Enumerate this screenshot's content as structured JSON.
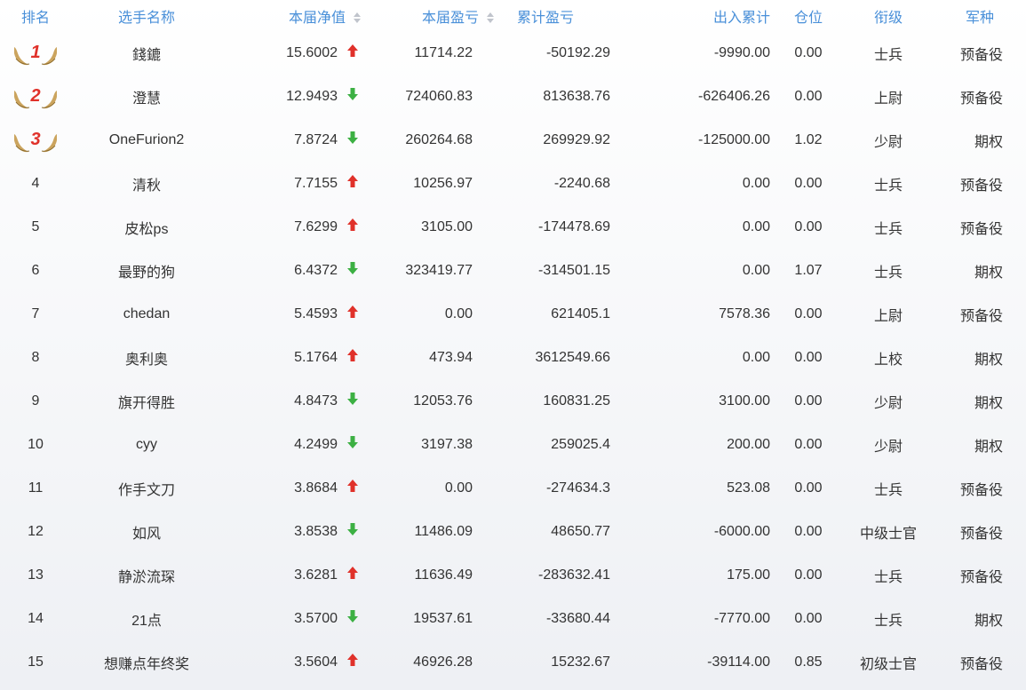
{
  "colors": {
    "header": "#4a90d9",
    "up": "#e0312a",
    "down": "#3cb043",
    "gold": "#c59a4c",
    "rank_red": "#e0312a"
  },
  "header": {
    "rank": "排名",
    "name": "选手名称",
    "net_value": "本届净值",
    "season_pnl": "本届盈亏",
    "total_pnl": "累计盈亏",
    "in_out": "出入累计",
    "position": "仓位",
    "grade": "衔级",
    "branch": "军种"
  },
  "rows": [
    {
      "rank": "1",
      "name": "錢鏕",
      "net_value": "15.6002",
      "trend": "up",
      "season_pnl": "11714.22",
      "total_pnl": "-50192.29",
      "in_out": "-9990.00",
      "position": "0.00",
      "grade": "士兵",
      "branch": "预备役"
    },
    {
      "rank": "2",
      "name": "澄慧",
      "net_value": "12.9493",
      "trend": "down",
      "season_pnl": "724060.83",
      "total_pnl": "813638.76",
      "in_out": "-626406.26",
      "position": "0.00",
      "grade": "上尉",
      "branch": "预备役"
    },
    {
      "rank": "3",
      "name": "OneFurion2",
      "net_value": "7.8724",
      "trend": "down",
      "season_pnl": "260264.68",
      "total_pnl": "269929.92",
      "in_out": "-125000.00",
      "position": "1.02",
      "grade": "少尉",
      "branch": "期权"
    },
    {
      "rank": "4",
      "name": "清秋",
      "net_value": "7.7155",
      "trend": "up",
      "season_pnl": "10256.97",
      "total_pnl": "-2240.68",
      "in_out": "0.00",
      "position": "0.00",
      "grade": "士兵",
      "branch": "预备役"
    },
    {
      "rank": "5",
      "name": "皮松ps",
      "net_value": "7.6299",
      "trend": "up",
      "season_pnl": "3105.00",
      "total_pnl": "-174478.69",
      "in_out": "0.00",
      "position": "0.00",
      "grade": "士兵",
      "branch": "预备役"
    },
    {
      "rank": "6",
      "name": "最野的狗",
      "net_value": "6.4372",
      "trend": "down",
      "season_pnl": "323419.77",
      "total_pnl": "-314501.15",
      "in_out": "0.00",
      "position": "1.07",
      "grade": "士兵",
      "branch": "期权"
    },
    {
      "rank": "7",
      "name": "chedan",
      "net_value": "5.4593",
      "trend": "up",
      "season_pnl": "0.00",
      "total_pnl": "621405.1",
      "in_out": "7578.36",
      "position": "0.00",
      "grade": "上尉",
      "branch": "预备役"
    },
    {
      "rank": "8",
      "name": "奥利奥",
      "net_value": "5.1764",
      "trend": "up",
      "season_pnl": "473.94",
      "total_pnl": "3612549.66",
      "in_out": "0.00",
      "position": "0.00",
      "grade": "上校",
      "branch": "期权"
    },
    {
      "rank": "9",
      "name": "旗开得胜",
      "net_value": "4.8473",
      "trend": "down",
      "season_pnl": "12053.76",
      "total_pnl": "160831.25",
      "in_out": "3100.00",
      "position": "0.00",
      "grade": "少尉",
      "branch": "期权"
    },
    {
      "rank": "10",
      "name": "cyy",
      "net_value": "4.2499",
      "trend": "down",
      "season_pnl": "3197.38",
      "total_pnl": "259025.4",
      "in_out": "200.00",
      "position": "0.00",
      "grade": "少尉",
      "branch": "期权"
    },
    {
      "rank": "11",
      "name": "作手文刀",
      "net_value": "3.8684",
      "trend": "up",
      "season_pnl": "0.00",
      "total_pnl": "-274634.3",
      "in_out": "523.08",
      "position": "0.00",
      "grade": "士兵",
      "branch": "预备役"
    },
    {
      "rank": "12",
      "name": "如风",
      "net_value": "3.8538",
      "trend": "down",
      "season_pnl": "11486.09",
      "total_pnl": "48650.77",
      "in_out": "-6000.00",
      "position": "0.00",
      "grade": "中级士官",
      "branch": "预备役"
    },
    {
      "rank": "13",
      "name": "静淤流琛",
      "net_value": "3.6281",
      "trend": "up",
      "season_pnl": "11636.49",
      "total_pnl": "-283632.41",
      "in_out": "175.00",
      "position": "0.00",
      "grade": "士兵",
      "branch": "预备役"
    },
    {
      "rank": "14",
      "name": "21点",
      "net_value": "3.5700",
      "trend": "down",
      "season_pnl": "19537.61",
      "total_pnl": "-33680.44",
      "in_out": "-7770.00",
      "position": "0.00",
      "grade": "士兵",
      "branch": "期权"
    },
    {
      "rank": "15",
      "name": "想赚点年终奖",
      "net_value": "3.5604",
      "trend": "up",
      "season_pnl": "46926.28",
      "total_pnl": "15232.67",
      "in_out": "-39114.00",
      "position": "0.85",
      "grade": "初级士官",
      "branch": "预备役"
    }
  ]
}
